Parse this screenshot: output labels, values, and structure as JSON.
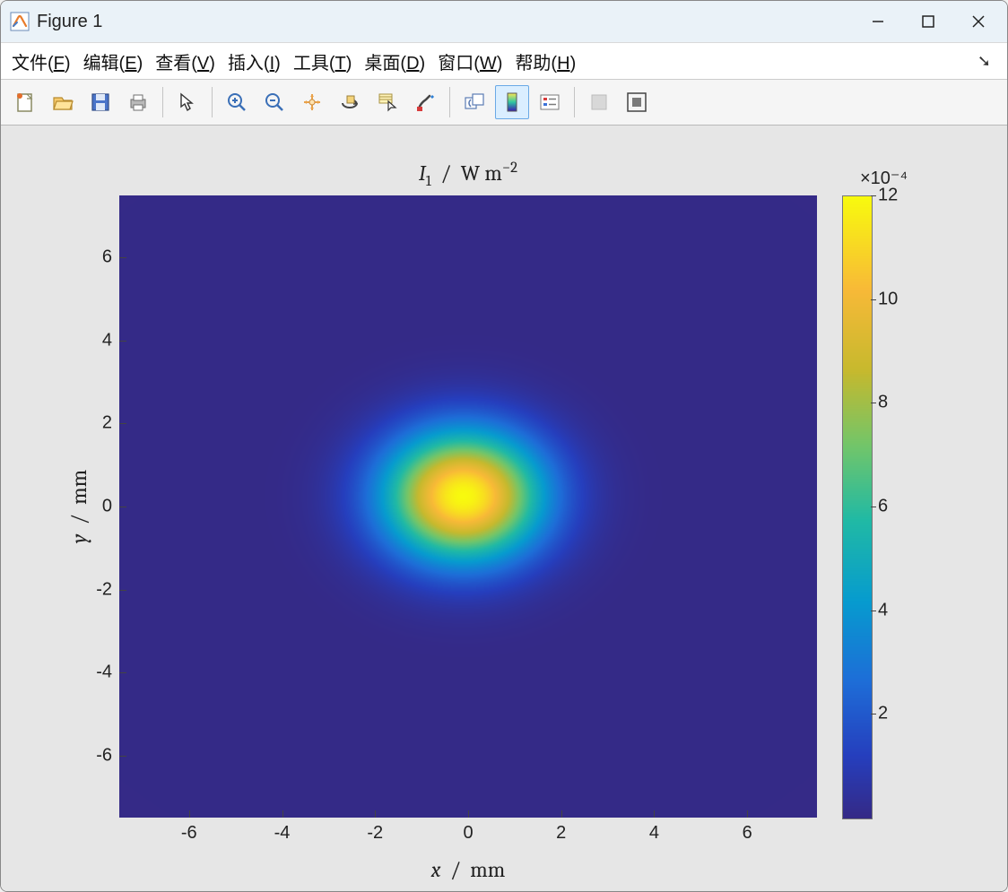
{
  "window": {
    "title": "Figure 1"
  },
  "menubar": {
    "items": [
      {
        "pre": "文件(",
        "hot": "F",
        "post": ")"
      },
      {
        "pre": "编辑(",
        "hot": "E",
        "post": ")"
      },
      {
        "pre": "查看(",
        "hot": "V",
        "post": ")"
      },
      {
        "pre": "插入(",
        "hot": "I",
        "post": ")"
      },
      {
        "pre": "工具(",
        "hot": "T",
        "post": ")"
      },
      {
        "pre": "桌面(",
        "hot": "D",
        "post": ")"
      },
      {
        "pre": "窗口(",
        "hot": "W",
        "post": ")"
      },
      {
        "pre": "帮助(",
        "hot": "H",
        "post": ")"
      }
    ]
  },
  "toolbar": {
    "buttons": [
      {
        "name": "new-figure",
        "group": 0
      },
      {
        "name": "open",
        "group": 0
      },
      {
        "name": "save",
        "group": 0
      },
      {
        "name": "print",
        "group": 0
      },
      {
        "name": "arrow",
        "group": 1
      },
      {
        "name": "zoom-in",
        "group": 2
      },
      {
        "name": "zoom-out",
        "group": 2
      },
      {
        "name": "pan",
        "group": 2
      },
      {
        "name": "rotate-3d",
        "group": 2
      },
      {
        "name": "data-cursor",
        "group": 2
      },
      {
        "name": "brush",
        "group": 2
      },
      {
        "name": "link",
        "group": 3
      },
      {
        "name": "colorbar",
        "group": 3,
        "active": true
      },
      {
        "name": "legend",
        "group": 3
      },
      {
        "name": "hide-tools",
        "group": 4,
        "disabled": true
      },
      {
        "name": "show-tools",
        "group": 4
      }
    ]
  },
  "chart_data": {
    "type": "heatmap",
    "title_html": "<span class='it'>I</span><sub>1</sub> &nbsp;/&nbsp; W m<sup>&minus;2</sup>",
    "xlabel_html": "<span class='it'>x</span> &nbsp;/&nbsp; mm",
    "ylabel_html": "<span class='it'>y</span> &nbsp;/&nbsp; mm",
    "xlim": [
      -7.5,
      7.5
    ],
    "ylim": [
      -7.5,
      7.5
    ],
    "xticks": [
      -6,
      -4,
      -2,
      0,
      2,
      4,
      6
    ],
    "yticks": [
      -6,
      -4,
      -2,
      0,
      2,
      4,
      6
    ],
    "gaussian": {
      "x0": -0.1,
      "y0": 0.25,
      "sigma_x": 1.7,
      "sigma_y": 1.55,
      "amplitude": 0.0012
    },
    "colorbar": {
      "exponent_label": "×10⁻⁴",
      "range": [
        0,
        0.0012
      ],
      "ticks": [
        2,
        4,
        6,
        8,
        10,
        12
      ],
      "tick_scale": 0.0001
    },
    "colormap": "parula"
  }
}
